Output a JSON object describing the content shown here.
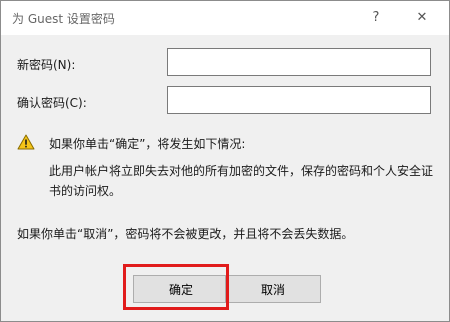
{
  "window": {
    "title": "为 Guest 设置密码",
    "help_glyph": "?",
    "close_glyph": "✕"
  },
  "form": {
    "new_password_label": "新密码(N):",
    "new_password_value": "",
    "confirm_password_label": "确认密码(C):",
    "confirm_password_value": ""
  },
  "warning": {
    "icon": "warning-triangle-icon",
    "headline": "如果你单击“确定”，将发生如下情况:",
    "consequence": "此用户帐户将立即失去对他的所有加密的文件，保存的密码和个人安全证书的访问权。"
  },
  "cancel_note": "如果你单击“取消”，密码将不会被更改，并且将不会丢失数据。",
  "buttons": {
    "ok_label": "确定",
    "cancel_label": "取消"
  },
  "colors": {
    "highlight": "#e11b1b",
    "warning_fill": "#f5c518",
    "dialog_background": "#f0f0f0"
  }
}
